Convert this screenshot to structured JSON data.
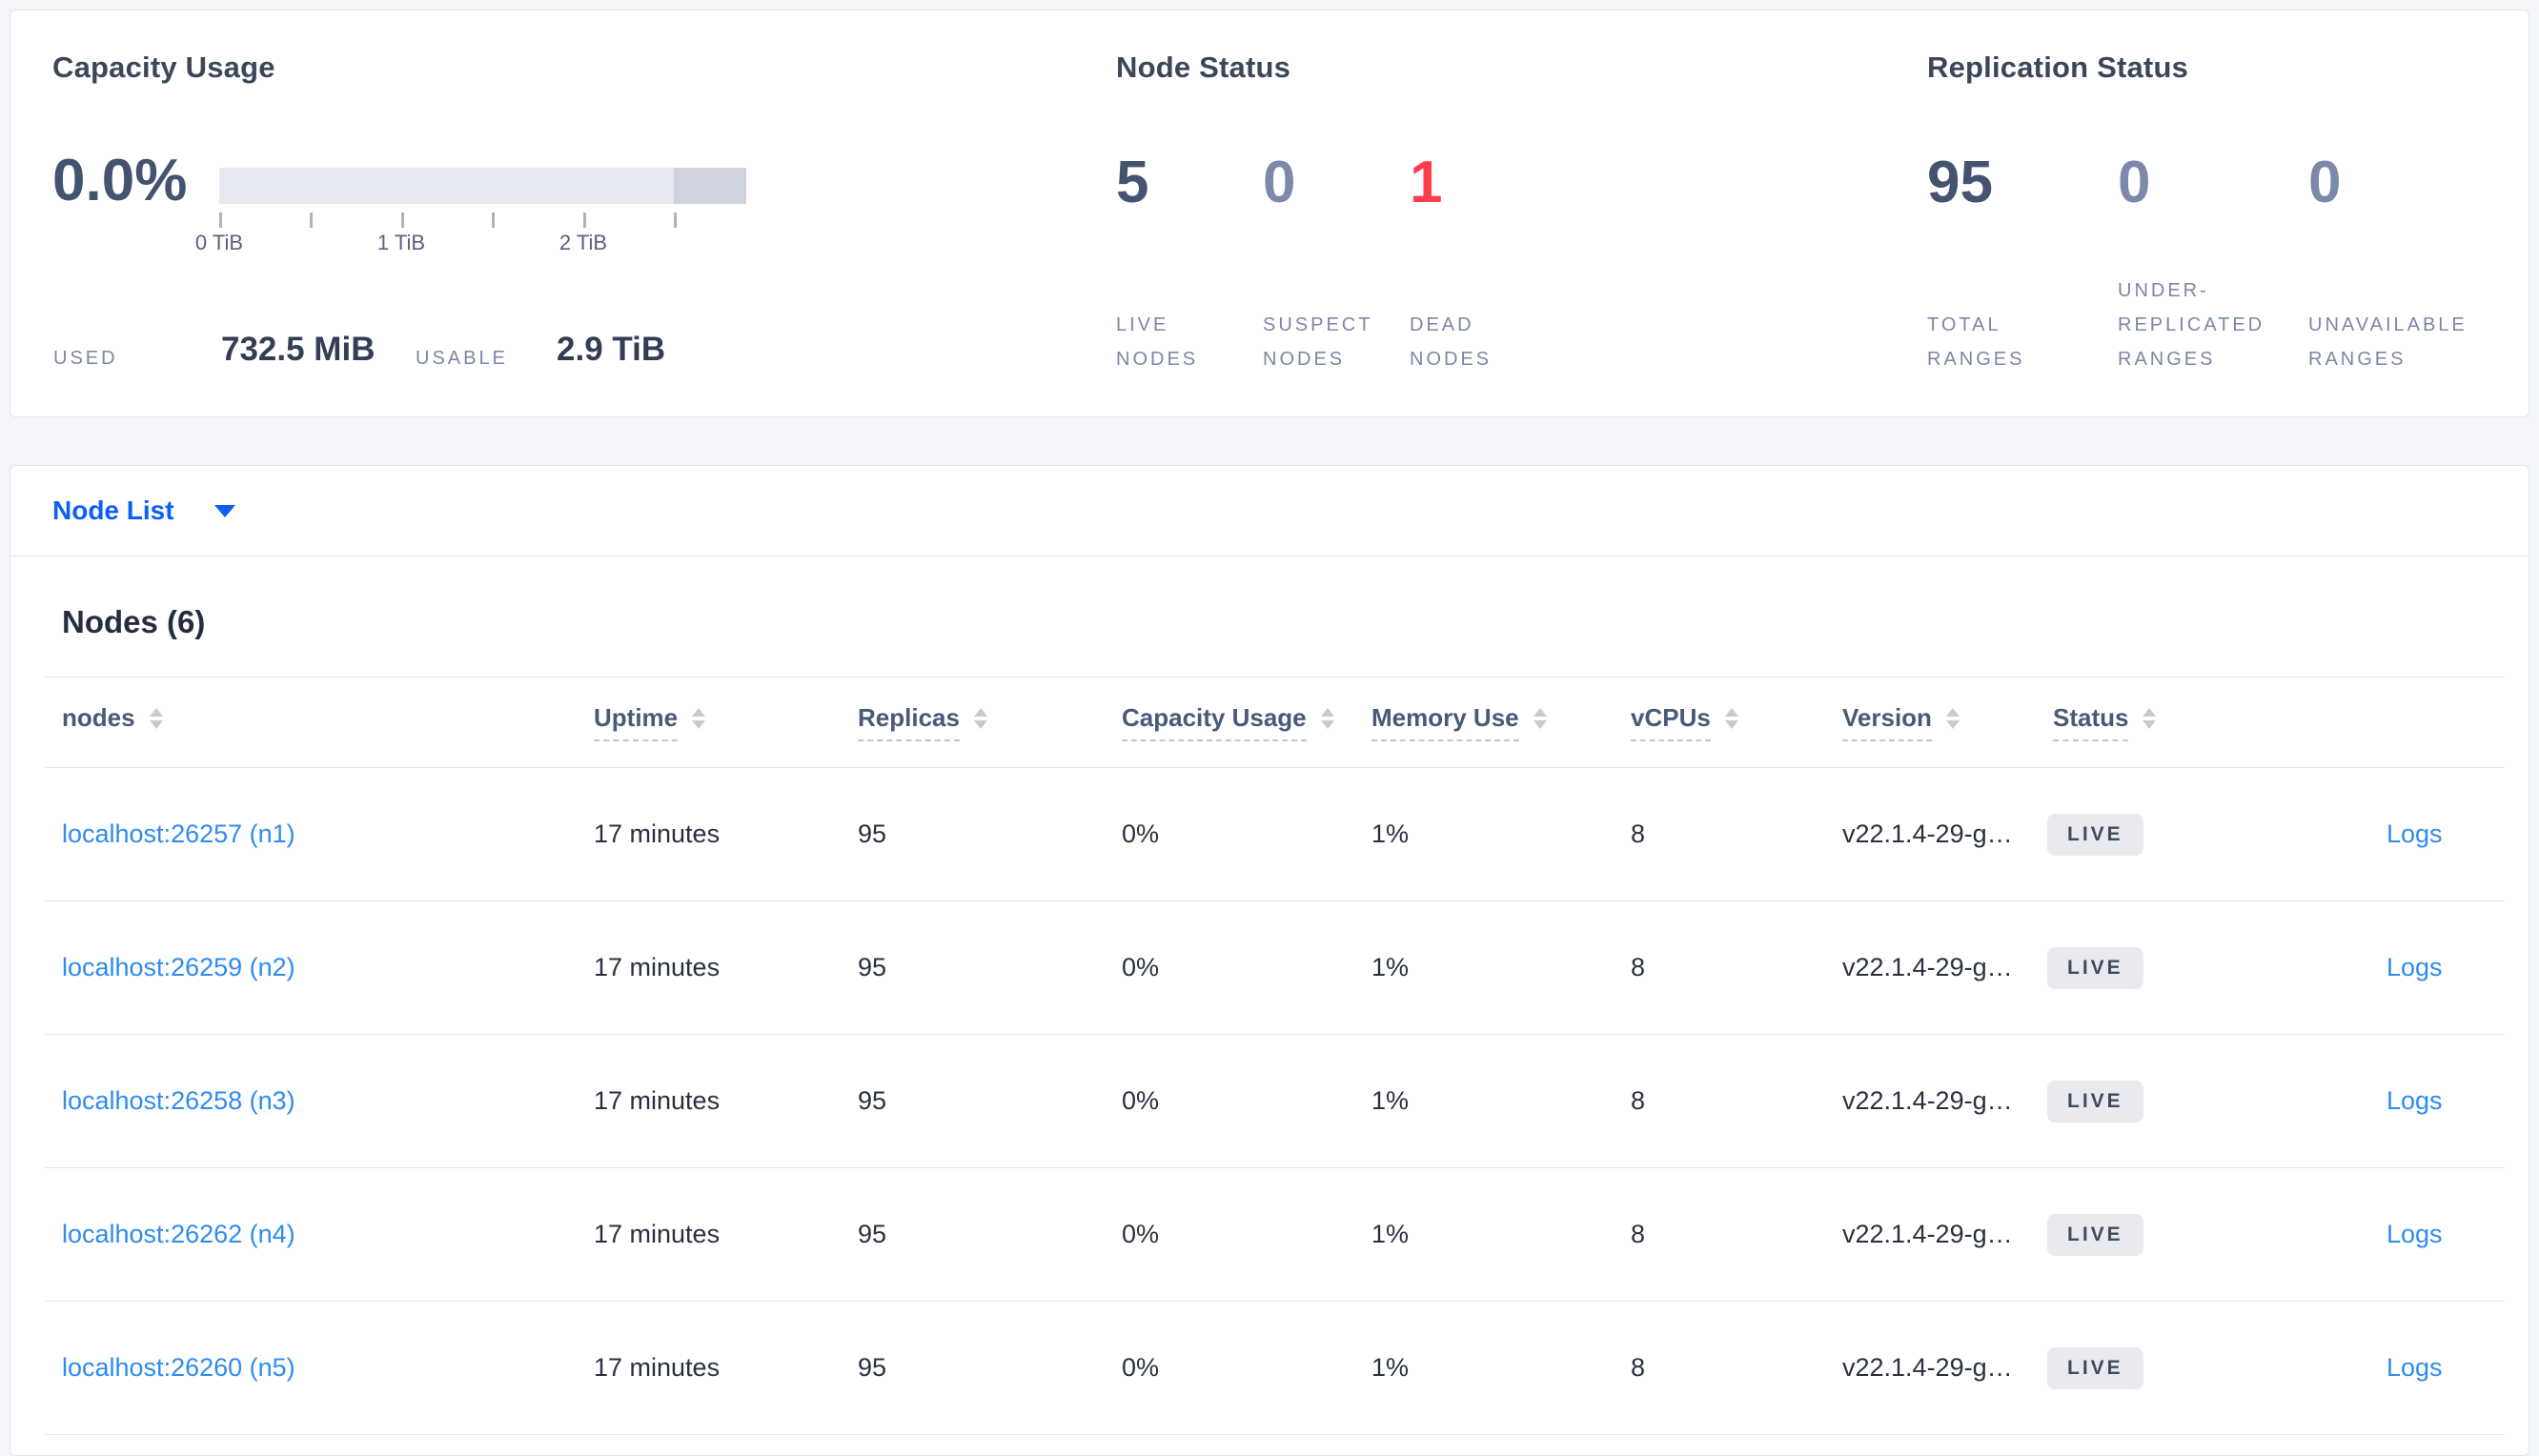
{
  "colors": {
    "accent_blue": "#0d5ef5",
    "link_blue": "#2f8bef",
    "dead_red": "#ff3c4c",
    "dark_number": "#44536f",
    "muted_number": "#7d89ab",
    "badge_bg": "#e8eaef",
    "bar_light": "#e8eaf1",
    "bar_dark": "#cfd3de"
  },
  "icons": {
    "view_selector_caret": "caret-down",
    "column_sort": "sort-arrows"
  },
  "capacity": {
    "title": "Capacity Usage",
    "percent_used": "0.0%",
    "axis_ticks": [
      "0 TiB",
      "1 TiB",
      "2 TiB"
    ],
    "used_label": "USED",
    "used_value": "732.5 MiB",
    "usable_label": "USABLE",
    "usable_value": "2.9 TiB"
  },
  "node_status": {
    "title": "Node Status",
    "stats": [
      {
        "value": "5",
        "tone": "dark",
        "label": "LIVE\nNODES"
      },
      {
        "value": "0",
        "tone": "muted",
        "label": "SUSPECT\nNODES"
      },
      {
        "value": "1",
        "tone": "red",
        "label": "DEAD\nNODES"
      }
    ]
  },
  "replication_status": {
    "title": "Replication Status",
    "stats": [
      {
        "value": "95",
        "tone": "dark",
        "label": "TOTAL\nRANGES"
      },
      {
        "value": "0",
        "tone": "muted",
        "label": "UNDER-\nREPLICATED\nRANGES"
      },
      {
        "value": "0",
        "tone": "muted",
        "label": "UNAVAILABLE\nRANGES"
      }
    ]
  },
  "view_selector": {
    "label": "Node List"
  },
  "nodes_table": {
    "heading": "Nodes (6)",
    "columns": [
      {
        "label": "nodes",
        "style": "plain"
      },
      {
        "label": "Uptime",
        "style": "underlined"
      },
      {
        "label": "Replicas",
        "style": "underlined"
      },
      {
        "label": "Capacity Usage",
        "style": "underlined"
      },
      {
        "label": "Memory Use",
        "style": "underlined"
      },
      {
        "label": "vCPUs",
        "style": "underlined"
      },
      {
        "label": "Version",
        "style": "underlined"
      },
      {
        "label": "Status",
        "style": "underlined"
      }
    ],
    "rows": [
      {
        "node": "localhost:26257 (n1)",
        "uptime": "17 minutes",
        "replicas": "95",
        "capacity": "0%",
        "memory": "1%",
        "vcpus": "8",
        "version": "v22.1.4-29-g…",
        "status": "LIVE",
        "logs": "Logs"
      },
      {
        "node": "localhost:26259 (n2)",
        "uptime": "17 minutes",
        "replicas": "95",
        "capacity": "0%",
        "memory": "1%",
        "vcpus": "8",
        "version": "v22.1.4-29-g…",
        "status": "LIVE",
        "logs": "Logs"
      },
      {
        "node": "localhost:26258 (n3)",
        "uptime": "17 minutes",
        "replicas": "95",
        "capacity": "0%",
        "memory": "1%",
        "vcpus": "8",
        "version": "v22.1.4-29-g…",
        "status": "LIVE",
        "logs": "Logs"
      },
      {
        "node": "localhost:26262 (n4)",
        "uptime": "17 minutes",
        "replicas": "95",
        "capacity": "0%",
        "memory": "1%",
        "vcpus": "8",
        "version": "v22.1.4-29-g…",
        "status": "LIVE",
        "logs": "Logs"
      },
      {
        "node": "localhost:26260 (n5)",
        "uptime": "17 minutes",
        "replicas": "95",
        "capacity": "0%",
        "memory": "1%",
        "vcpus": "8",
        "version": "v22.1.4-29-g…",
        "status": "LIVE",
        "logs": "Logs"
      }
    ]
  }
}
